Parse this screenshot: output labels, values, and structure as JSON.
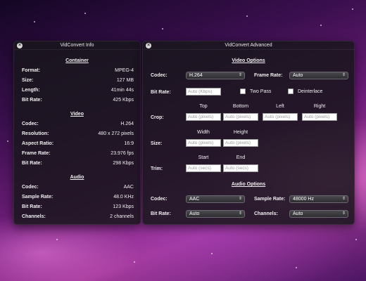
{
  "info": {
    "title": "VidConvert Info",
    "container": {
      "heading": "Container",
      "rows": [
        {
          "label": "Format:",
          "value": "MPEG-4"
        },
        {
          "label": "Size:",
          "value": "127 MB"
        },
        {
          "label": "Length:",
          "value": "41min 44s"
        },
        {
          "label": "Bit Rate:",
          "value": "425 Kbps"
        }
      ]
    },
    "video": {
      "heading": "Video",
      "rows": [
        {
          "label": "Codec:",
          "value": "H.264"
        },
        {
          "label": "Resolution:",
          "value": "480 x 272 pixels"
        },
        {
          "label": "Aspect Ratio:",
          "value": "16:9"
        },
        {
          "label": "Frame Rate:",
          "value": "23.976 fps"
        },
        {
          "label": "Bit Rate:",
          "value": "298 Kbps"
        }
      ]
    },
    "audio": {
      "heading": "Audio",
      "rows": [
        {
          "label": "Codec:",
          "value": "AAC"
        },
        {
          "label": "Sample Rate:",
          "value": "48.0 KHz"
        },
        {
          "label": "Bit Rate:",
          "value": "123 Kbps"
        },
        {
          "label": "Channels:",
          "value": "2 channels"
        }
      ]
    }
  },
  "advanced": {
    "title": "VidConvert Advanced",
    "video_options": {
      "heading": "Video Options",
      "codec_label": "Codec:",
      "codec_value": "H.264",
      "frame_rate_label": "Frame Rate:",
      "frame_rate_value": "Auto",
      "bit_rate_label": "Bit Rate:",
      "bit_rate_placeholder": "Auto (Kbps)",
      "two_pass_label": "Two Pass",
      "deinterlace_label": "Deinterlace",
      "crop_label": "Crop:",
      "crop_columns": [
        "Top",
        "Bottom",
        "Left",
        "Right"
      ],
      "crop_placeholder": "Auto (pixels)",
      "size_label": "Size:",
      "size_columns": [
        "Width",
        "Height"
      ],
      "size_placeholder": "Auto (pixels)",
      "trim_label": "Trim:",
      "trim_columns": [
        "Start",
        "End"
      ],
      "trim_placeholder": "Auto (secs)"
    },
    "audio_options": {
      "heading": "Audio Options",
      "codec_label": "Codec:",
      "codec_value": "AAC",
      "sample_rate_label": "Sample Rate:",
      "sample_rate_value": "48000 Hz",
      "bit_rate_label": "Bit Rate:",
      "bit_rate_value": "Auto",
      "channels_label": "Channels:",
      "channels_value": "Auto"
    }
  },
  "icons": {
    "close": "close-icon",
    "popup_arrows": "updown-arrows-icon"
  },
  "colors": {
    "panel": "#18161c",
    "desktop_accent": "#a53a9b"
  }
}
